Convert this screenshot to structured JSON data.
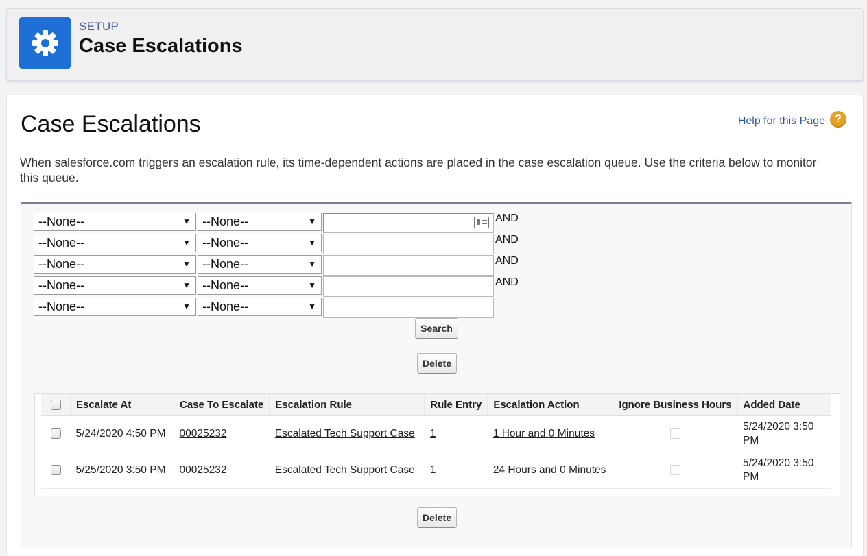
{
  "header": {
    "kicker": "SETUP",
    "title": "Case Escalations",
    "icon": "gear-icon"
  },
  "page": {
    "title": "Case Escalations",
    "help_link": "Help for this Page",
    "help_icon": "?",
    "intro": "When salesforce.com triggers an escalation rule, its time-dependent actions are placed in the case escalation queue. Use the criteria below to monitor this queue."
  },
  "filters": [
    {
      "field": "--None--",
      "operator": "--None--",
      "value": "",
      "conjunction": "AND"
    },
    {
      "field": "--None--",
      "operator": "--None--",
      "value": "",
      "conjunction": "AND"
    },
    {
      "field": "--None--",
      "operator": "--None--",
      "value": "",
      "conjunction": "AND"
    },
    {
      "field": "--None--",
      "operator": "--None--",
      "value": "",
      "conjunction": "AND"
    },
    {
      "field": "--None--",
      "operator": "--None--",
      "value": "",
      "conjunction": ""
    }
  ],
  "buttons": {
    "search": "Search",
    "delete_top": "Delete",
    "delete_bottom": "Delete"
  },
  "table": {
    "columns": [
      "Escalate At",
      "Case To Escalate",
      "Escalation Rule",
      "Rule Entry",
      "Escalation Action",
      "Ignore Business Hours",
      "Added Date"
    ],
    "rows": [
      {
        "escalate_at": "5/24/2020 4:50 PM",
        "case": "00025232",
        "rule": "Escalated Tech Support Case",
        "entry": "1",
        "action": "1 Hour and 0 Minutes",
        "ignore_business_hours": false,
        "added": "5/24/2020 3:50 PM"
      },
      {
        "escalate_at": "5/25/2020 3:50 PM",
        "case": "00025232",
        "rule": "Escalated Tech Support Case",
        "entry": "1",
        "action": "24 Hours and 0 Minutes",
        "ignore_business_hours": false,
        "added": "5/24/2020 3:50 PM"
      }
    ]
  },
  "colors": {
    "accent": "#1e70d6",
    "link": "#2b5a9f",
    "panel_top_border": "#7b7f97",
    "help_icon": "#e6a124"
  }
}
